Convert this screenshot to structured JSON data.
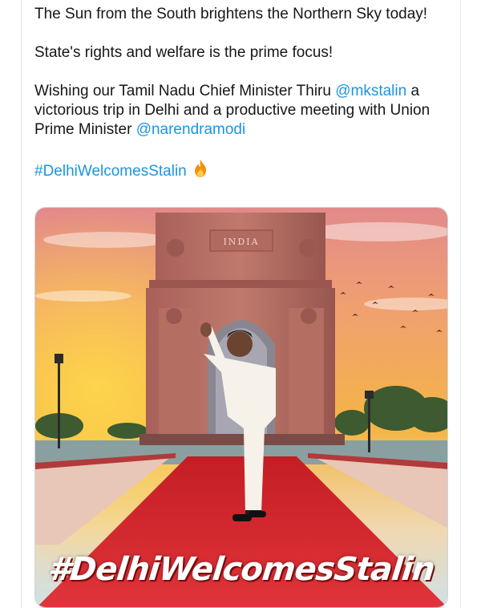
{
  "tweet": {
    "line1": "The Sun from the South brightens the Northern Sky today!",
    "line2": "State's rights and welfare is the prime focus!",
    "line3_before": "Wishing our Tamil Nadu Chief Minister Thiru ",
    "mention1": "@mkstalin",
    "line3_middle": " a victorious trip in Delhi and a productive meeting with Union Prime Minister ",
    "mention2": "@narendramodi",
    "hashtag": "#DelhiWelcomesStalin",
    "emoji": "fire-icon"
  },
  "media": {
    "image_subject": "India Gate poster",
    "monument_inscription": "INDIA",
    "overlay_text": "#DelhiWelcomesStalin"
  },
  "colors": {
    "link": "#1b95e0",
    "text": "#14171a",
    "carpet": "#d7262c",
    "sky_top": "#e8a47a",
    "sky_glow": "#f5b13a"
  }
}
